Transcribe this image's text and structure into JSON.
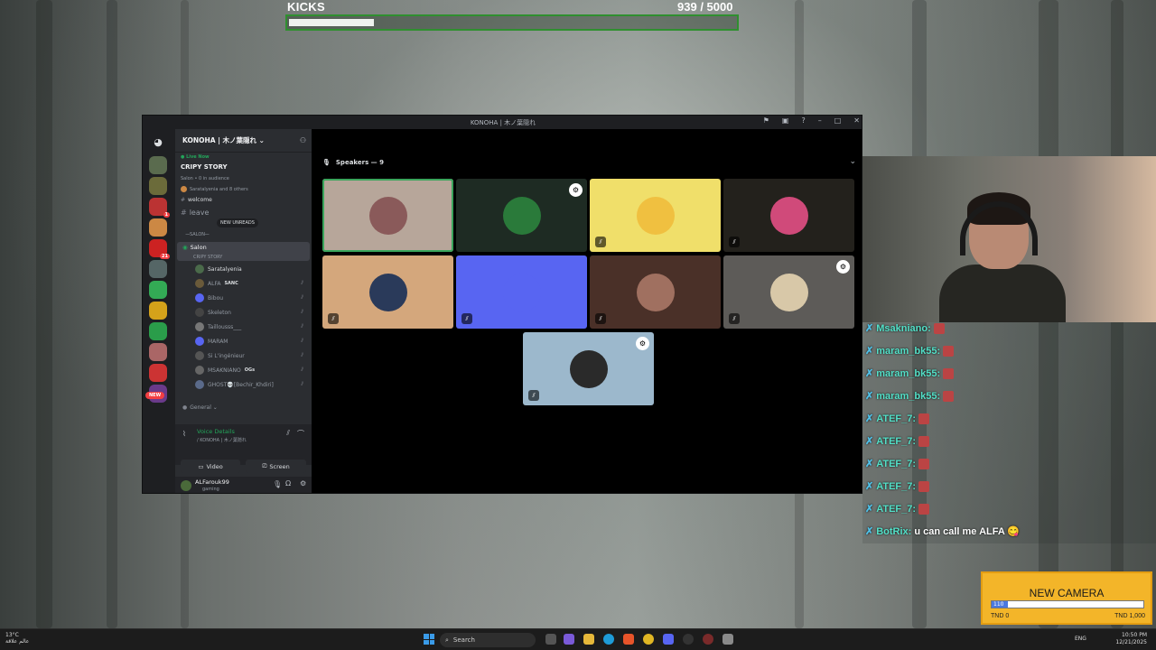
{
  "kicks": {
    "title": "KICKS",
    "count": "939",
    "goal": "/ 5000",
    "progress": 0.188
  },
  "window": {
    "title": "KONOHA | 木ノ葉隠れ",
    "server_name": "KONOHA | 木ノ葉隠れ ⌄",
    "live_now": "● Live Now",
    "story_title": "CRIPY STORY",
    "story_meta": "Salon • 0 in audience",
    "story_people": "Saratalyenia and 8 others",
    "welcome": "welcome",
    "leave_channel": "leave",
    "new_unreads": "NEW UNREADS",
    "category_salon": "╶─SALON─╴",
    "salon_name": "Salon",
    "salon_sub": "CRIPY STORY",
    "members": [
      {
        "name": "Saratalyenia",
        "tag": ""
      },
      {
        "name": "ALFA",
        "tag": "SANC"
      },
      {
        "name": "Bibou",
        "tag": ""
      },
      {
        "name": "Skeleton",
        "tag": ""
      },
      {
        "name": "Taillousss___",
        "tag": ""
      },
      {
        "name": "MARAM",
        "tag": ""
      },
      {
        "name": "Si L'ingénieur",
        "tag": ""
      },
      {
        "name": "MSAKNIANO",
        "tag": "OGs"
      },
      {
        "name": "GHOST💀[Bechir_Khdiri]",
        "tag": ""
      }
    ],
    "category_general": "General ⌄",
    "new_badge": "NEW",
    "voice_details": "Voice Details",
    "voice_server": "/ KONOHA | 木ノ葉隠れ",
    "video_label": "Video",
    "screen_label": "Screen",
    "username": "ALFarouk99",
    "user_status": "gaming",
    "speakers_label": "Speakers — 9"
  },
  "tiles": [
    {
      "name": "speaker-1",
      "bg": "#b7a69a",
      "badge": false,
      "mute": false,
      "border": "#3ba55c"
    },
    {
      "name": "speaker-2",
      "bg": "#1e2b23",
      "badge": true,
      "mute": false
    },
    {
      "name": "speaker-3",
      "bg": "#f0df6a",
      "badge": false,
      "mute": true
    },
    {
      "name": "speaker-4",
      "bg": "#23211c",
      "badge": false,
      "mute": true
    },
    {
      "name": "speaker-5",
      "bg": "#d4a77c",
      "badge": false,
      "mute": true
    },
    {
      "name": "speaker-6",
      "bg": "#5865f2",
      "badge": false,
      "mute": true
    },
    {
      "name": "speaker-7",
      "bg": "#4a3028",
      "badge": false,
      "mute": true
    },
    {
      "name": "speaker-8",
      "bg": "#5d5b58",
      "badge": true,
      "mute": true
    },
    {
      "name": "speaker-9",
      "bg": "#9cb8cc",
      "badge": true,
      "mute": true
    }
  ],
  "chat": [
    {
      "user": "Msakniano:",
      "msg": "",
      "emote": true
    },
    {
      "user": "maram_bk55:",
      "msg": "",
      "emote": true
    },
    {
      "user": "maram_bk55:",
      "msg": "",
      "emote": true
    },
    {
      "user": "maram_bk55:",
      "msg": "",
      "emote": true
    },
    {
      "user": "ATEF_7:",
      "msg": "",
      "emote": true
    },
    {
      "user": "ATEF_7:",
      "msg": "",
      "emote": true
    },
    {
      "user": "ATEF_7:",
      "msg": "",
      "emote": true
    },
    {
      "user": "ATEF_7:",
      "msg": "",
      "emote": true
    },
    {
      "user": "ATEF_7:",
      "msg": "",
      "emote": true
    },
    {
      "user": "BotRix:",
      "msg": "u can call me ALFA 😋",
      "emote": false
    }
  ],
  "new_camera": {
    "title": "NEW CAMERA",
    "current": "110",
    "progress": 0.11,
    "min": "TND 0",
    "max": "TND 1,000"
  },
  "taskbar": {
    "weather": "13°C",
    "weather_sub": "عالم علاقة",
    "search": "Search",
    "lang": "ENG",
    "time": "10:50 PM",
    "date": "12/21/2025"
  }
}
